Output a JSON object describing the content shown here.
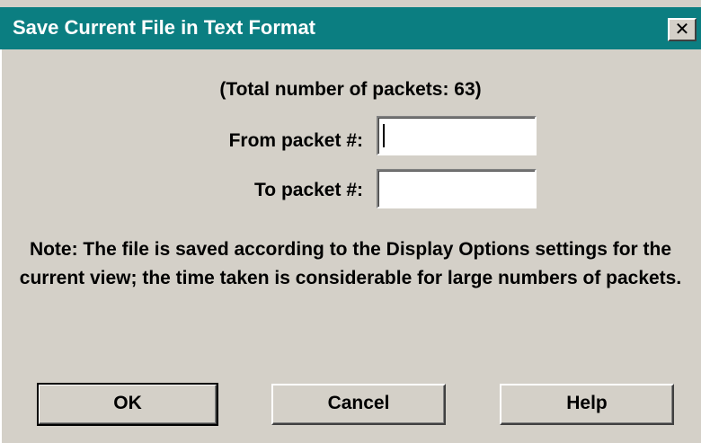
{
  "window": {
    "title": "Save Current File in Text Format",
    "close_label": "×"
  },
  "dialog": {
    "total_text": "(Total number of packets: 63)",
    "from_label": "From packet #:",
    "from_value": "",
    "to_label": "To packet #:",
    "to_value": "",
    "note": "Note: The file is saved according to the Display Options settings for the current view; the time taken is considerable for large numbers of packets."
  },
  "buttons": {
    "ok": "OK",
    "cancel": "Cancel",
    "help": "Help"
  },
  "colors": {
    "titlebar": "#0b7e81",
    "face": "#d4d0c8"
  }
}
